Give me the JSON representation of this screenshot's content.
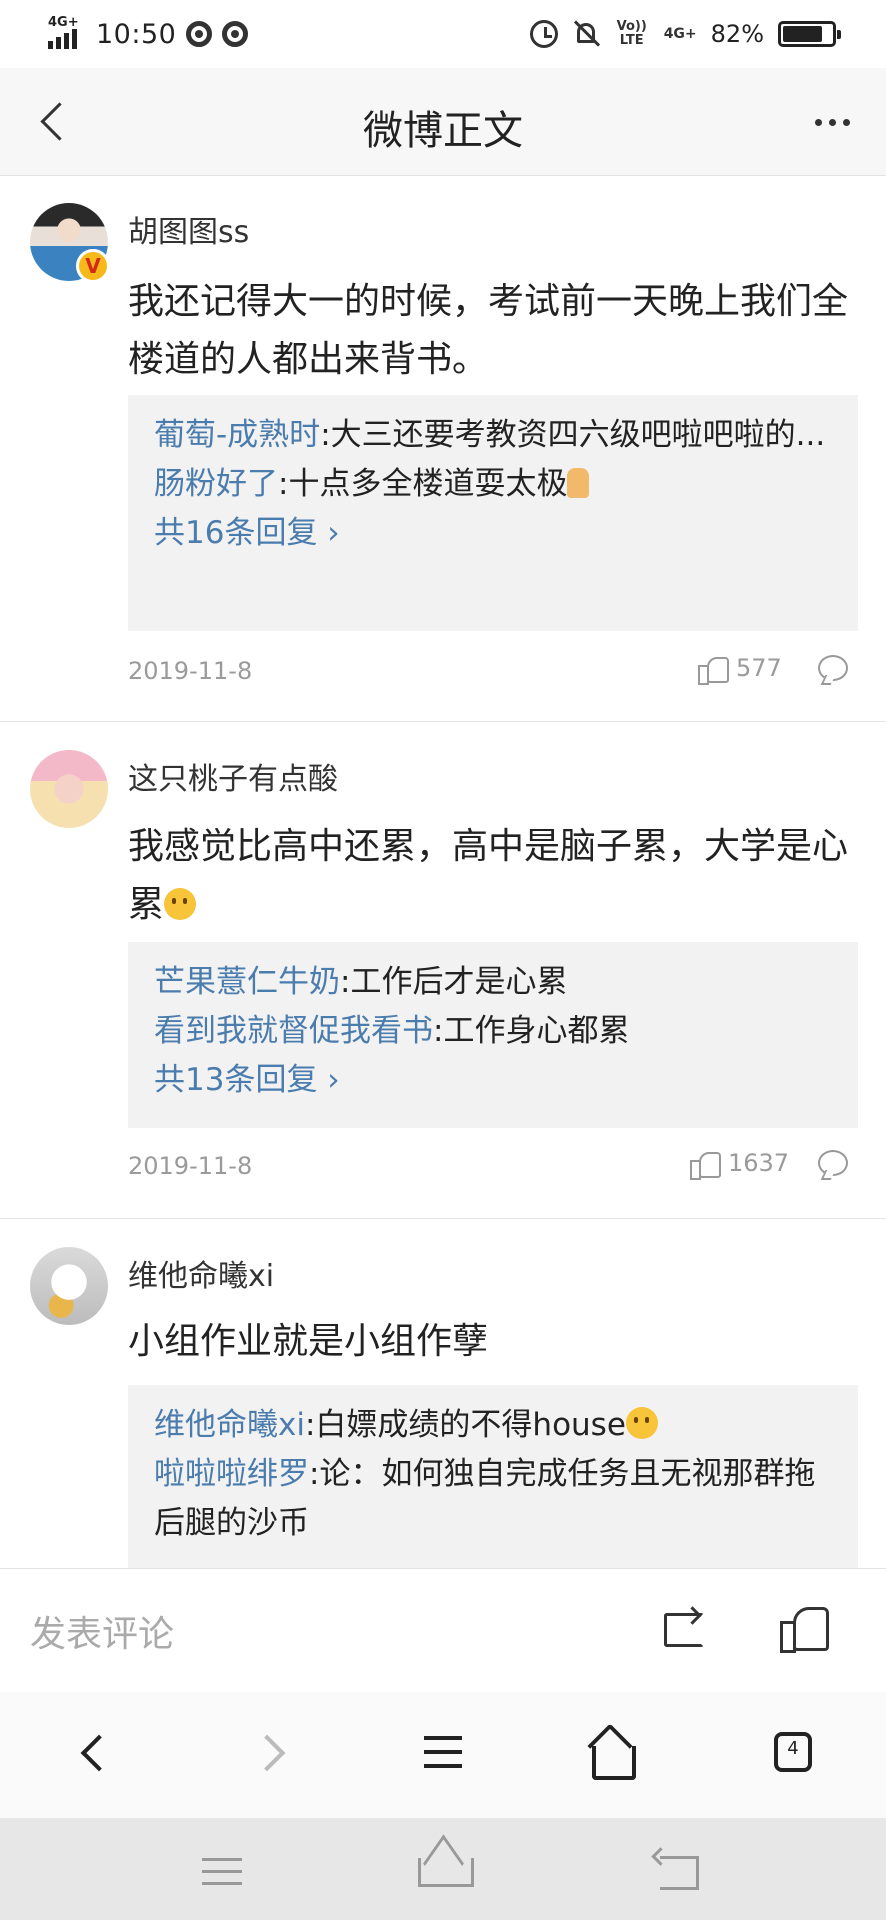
{
  "status_bar": {
    "network_tag": "4G+",
    "time": "10:50",
    "volte": "Vo)) LTE",
    "network_right": "4G+",
    "battery_percent": "82%",
    "battery_level": 0.82
  },
  "header": {
    "title": "微博正文"
  },
  "comments": [
    {
      "username": "胡图图ss",
      "verified_badge": "V",
      "content": "我还记得大一的时候，考试前一天晚上我们全楼道的人都出来背书。",
      "replies": [
        {
          "name": "葡萄-成熟时",
          "sep": ":",
          "text": "大三还要考教资四六级吧啦吧啦的..."
        },
        {
          "name": "肠粉好了",
          "sep": ":",
          "text": "十点多全楼道耍太极",
          "emoji": "thumbs-up-emoji"
        }
      ],
      "more_replies": "共16条回复 ›",
      "date": "2019-11-8",
      "likes": "577"
    },
    {
      "username": "这只桃子有点酸",
      "content": "我感觉比高中还累，高中是脑子累，大学是心累",
      "content_emoji": "thinking-emoji",
      "replies": [
        {
          "name": "芒果薏仁牛奶",
          "sep": ":",
          "text": "工作后才是心累"
        },
        {
          "name": "看到我就督促我看书",
          "sep": ":",
          "text": "工作身心都累"
        }
      ],
      "more_replies": "共13条回复 ›",
      "date": "2019-11-8",
      "likes": "1637"
    },
    {
      "username": "维他命曦xi",
      "content": "小组作业就是小组作孽",
      "replies": [
        {
          "name": "维他命曦xi",
          "sep": ":",
          "text": "白嫖成绩的不得house",
          "emoji": "thinking-emoji"
        },
        {
          "name": "啦啦啦绯罗",
          "sep": ":",
          "text": "论：如何独自完成任务且无视那群拖后腿的沙币"
        }
      ]
    }
  ],
  "comment_bar": {
    "placeholder": "发表评论"
  },
  "browser_bar": {
    "tab_count": "4"
  },
  "colors": {
    "link": "#4b7cae",
    "reply_bg": "#f2f2f2",
    "header_bg": "#f7f7f7"
  }
}
